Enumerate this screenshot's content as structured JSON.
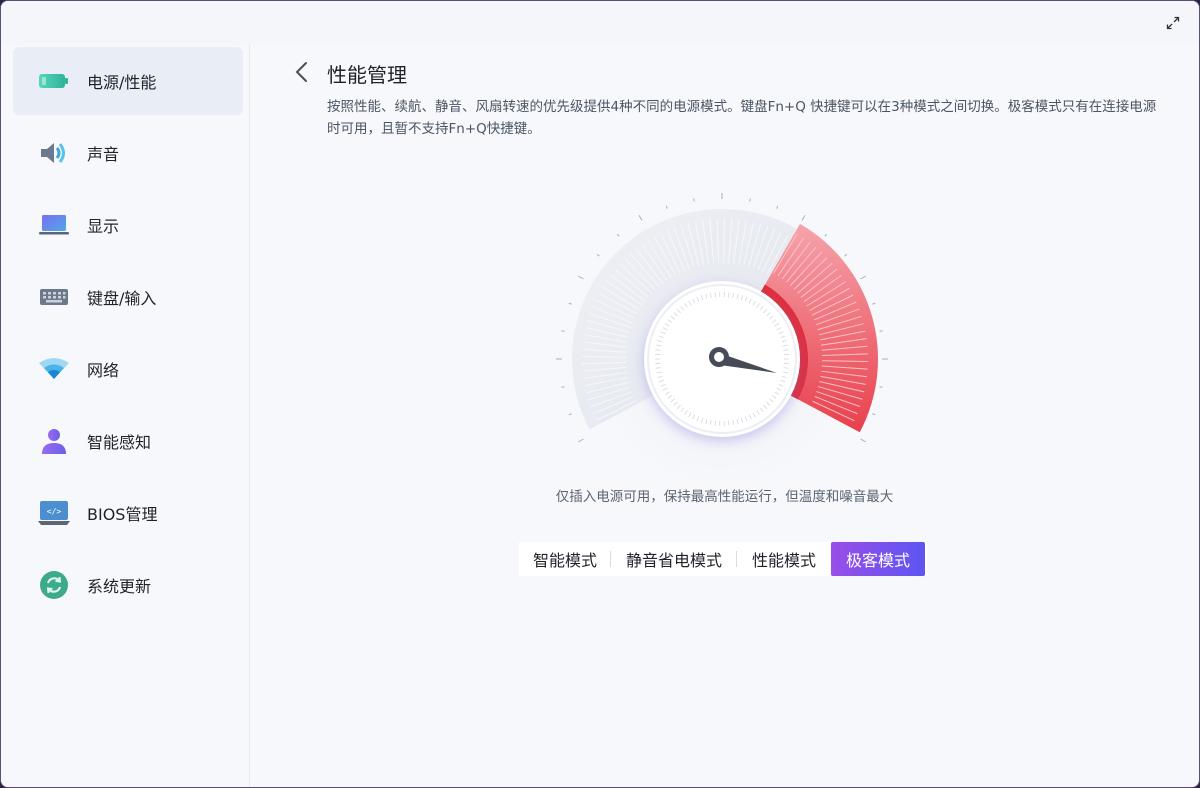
{
  "sidebar": {
    "items": [
      {
        "label": "电源/性能",
        "icon": "battery-icon",
        "active": true
      },
      {
        "label": "声音",
        "icon": "speaker-icon"
      },
      {
        "label": "显示",
        "icon": "laptop-display-icon"
      },
      {
        "label": "键盘/输入",
        "icon": "keyboard-icon"
      },
      {
        "label": "网络",
        "icon": "wifi-icon"
      },
      {
        "label": "智能感知",
        "icon": "person-icon"
      },
      {
        "label": "BIOS管理",
        "icon": "bios-code-icon"
      },
      {
        "label": "系统更新",
        "icon": "refresh-icon"
      }
    ]
  },
  "page": {
    "title": "性能管理",
    "description": "按照性能、续航、静音、风扇转速的优先级提供4种不同的电源模式。键盘Fn+Q 快捷键可以在3种模式之间切换。极客模式只有在连接电源时可用，且暂不支持Fn+Q快捷键。"
  },
  "gauge": {
    "description": "仅插入电源可用，保持最高性能运行，但温度和噪音最大",
    "active_color": "#e8404c",
    "inactive_color": "#e6e9f0"
  },
  "modes": {
    "items": [
      "智能模式",
      "静音省电模式",
      "性能模式",
      "极客模式"
    ],
    "selected": "极客模式"
  },
  "colors": {
    "accent_start": "#9a4ee8",
    "accent_end": "#5d55f2"
  }
}
